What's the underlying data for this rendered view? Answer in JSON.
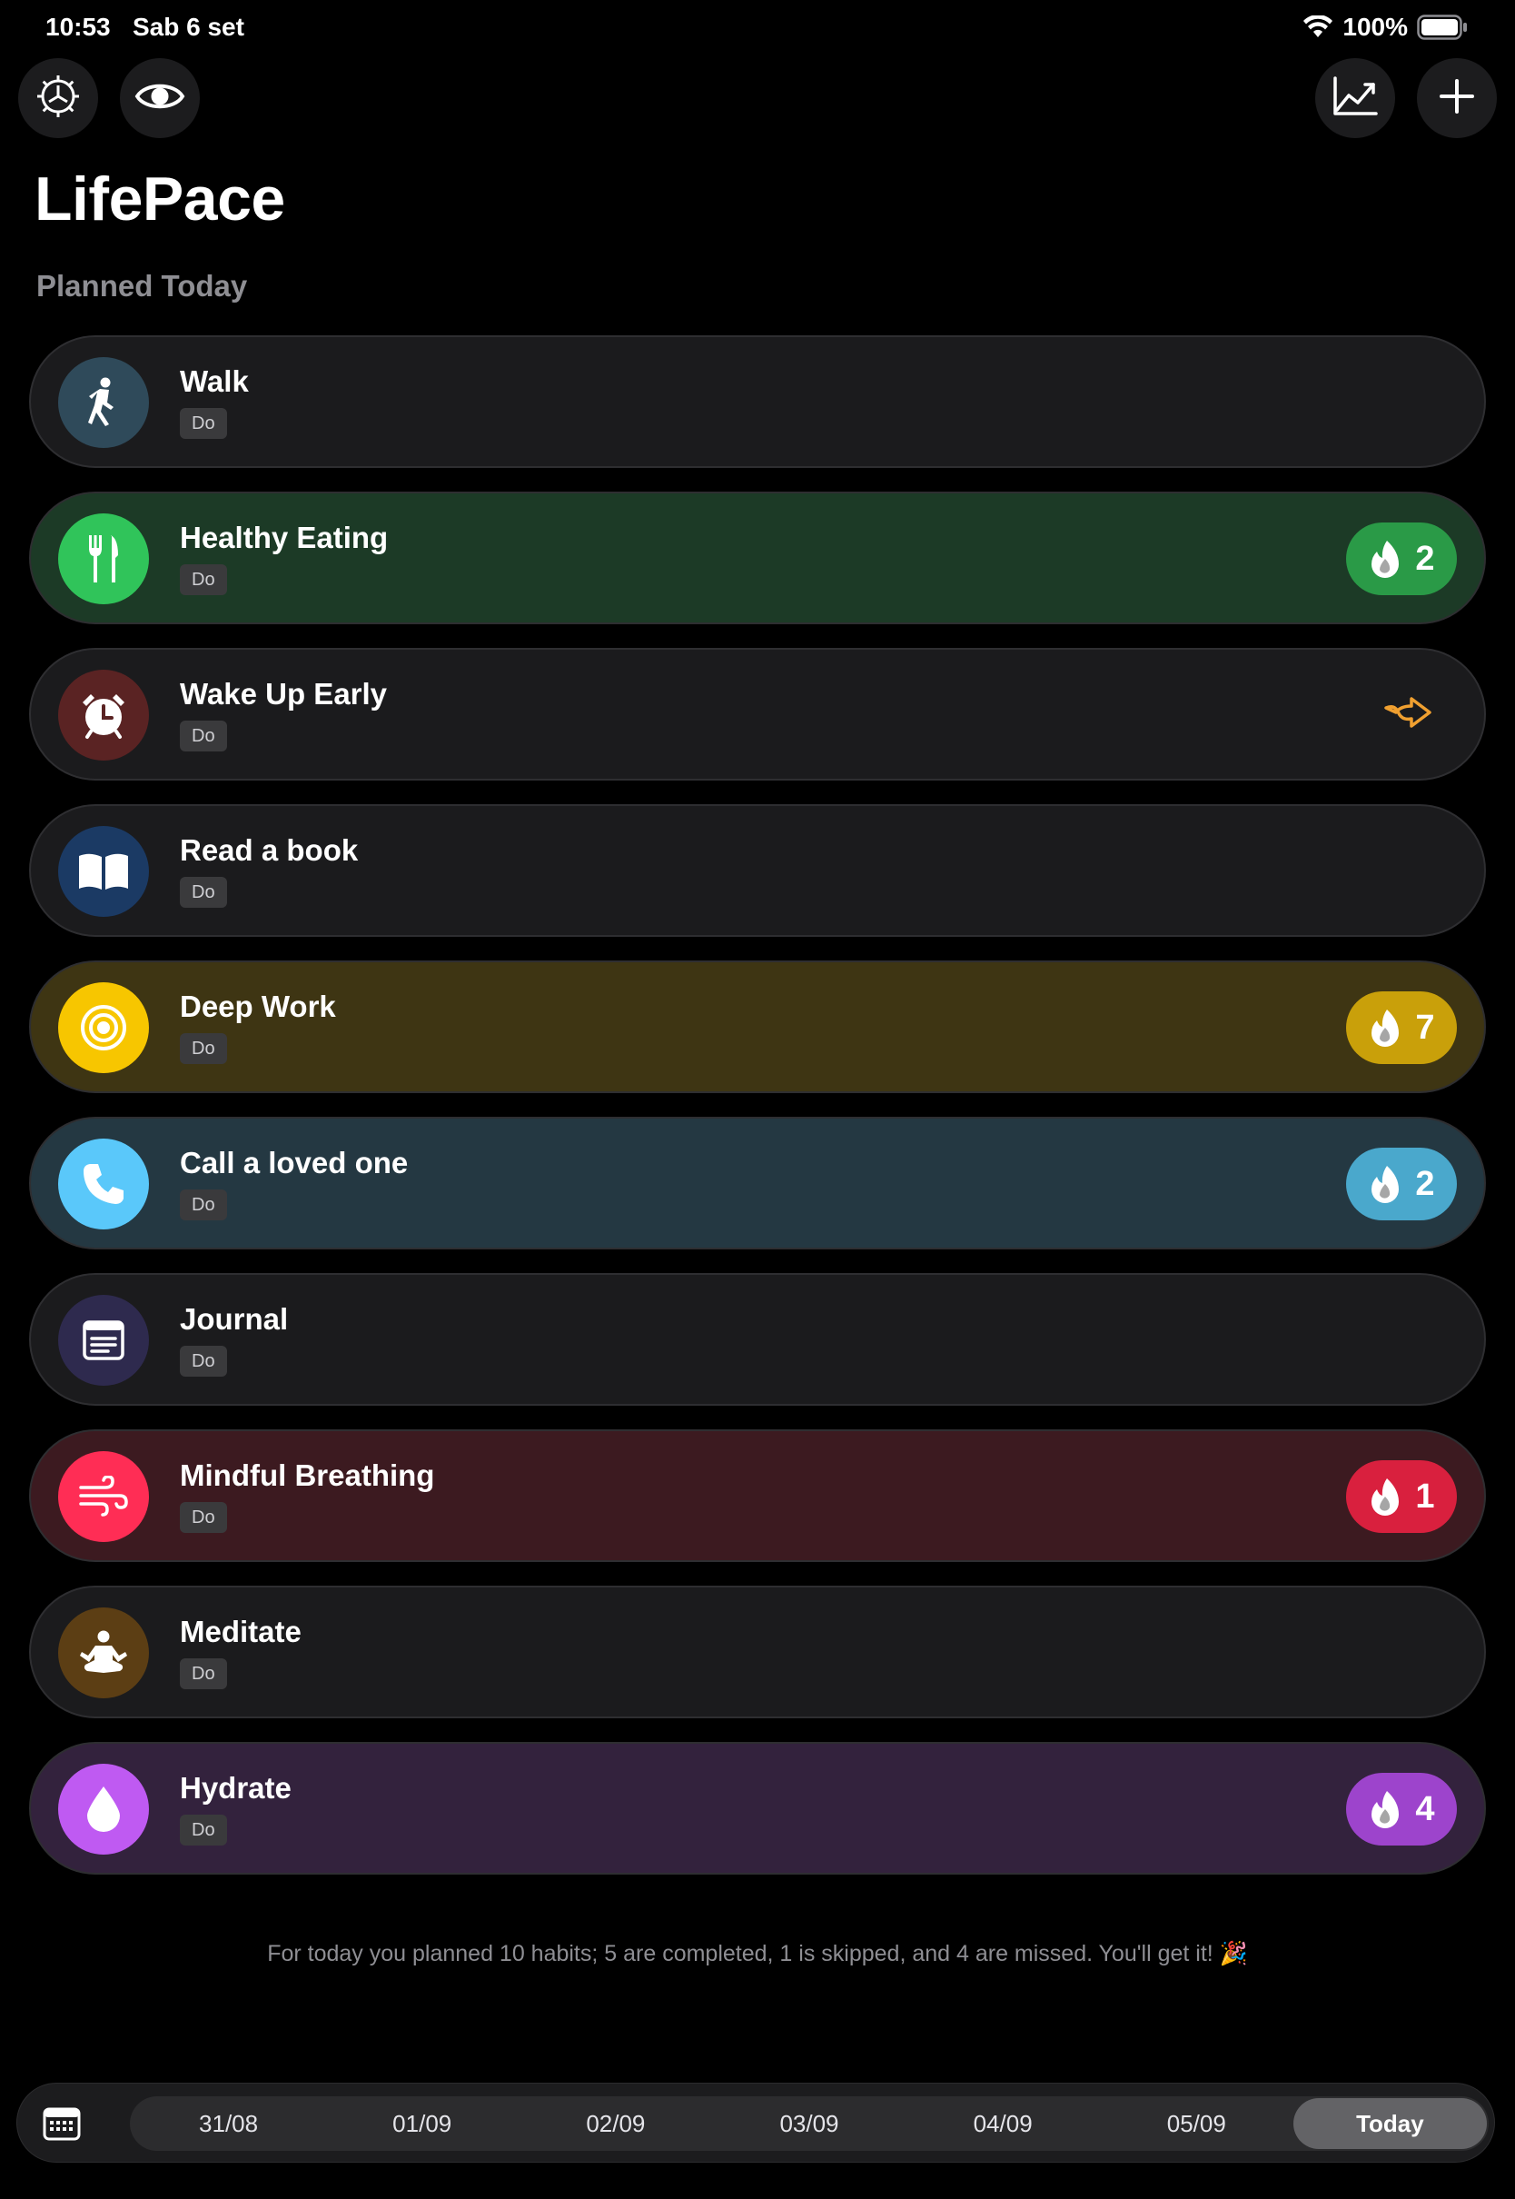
{
  "status_bar": {
    "time": "10:53",
    "date": "Sab 6 set",
    "battery": "100%"
  },
  "toolbar": {
    "left_icons": [
      "settings-gear-icon",
      "eye-icon"
    ],
    "right_icons": [
      "chart-line-icon",
      "plus-icon"
    ]
  },
  "app_title": "LifePace",
  "section_title": "Planned Today",
  "habits": [
    {
      "name": "Walk",
      "tag": "Do",
      "icon": "walk-icon",
      "streak": null,
      "bg": "#1b1b1d",
      "icon_bg": "#2f4a5a"
    },
    {
      "name": "Healthy Eating",
      "tag": "Do",
      "icon": "fork-knife-icon",
      "streak": "2",
      "bg": "#1c3a26",
      "icon_bg": "#30c45a",
      "badge_bg": "#2a9a47"
    },
    {
      "name": "Wake Up Early",
      "tag": "Do",
      "icon": "alarm-clock-icon",
      "streak": null,
      "skipped": true,
      "bg": "#1b1b1d",
      "icon_bg": "#5a2323"
    },
    {
      "name": "Read a book",
      "tag": "Do",
      "icon": "book-icon",
      "streak": null,
      "bg": "#1b1b1d",
      "icon_bg": "#1b3a64"
    },
    {
      "name": "Deep Work",
      "tag": "Do",
      "icon": "target-icon",
      "streak": "7",
      "bg": "#3e3513",
      "icon_bg": "#f7c600",
      "badge_bg": "#c9a00a"
    },
    {
      "name": "Call a loved one",
      "tag": "Do",
      "icon": "phone-icon",
      "streak": "2",
      "bg": "#243842",
      "icon_bg": "#5ac8fa",
      "badge_bg": "#4aa8cc"
    },
    {
      "name": "Journal",
      "tag": "Do",
      "icon": "journal-icon",
      "streak": null,
      "bg": "#1b1b1d",
      "icon_bg": "#2e2a4e"
    },
    {
      "name": "Mindful Breathing",
      "tag": "Do",
      "icon": "wind-icon",
      "streak": "1",
      "bg": "#3c1a20",
      "icon_bg": "#ff2d55",
      "badge_bg": "#d9203e"
    },
    {
      "name": "Meditate",
      "tag": "Do",
      "icon": "meditate-icon",
      "streak": null,
      "bg": "#1b1b1d",
      "icon_bg": "#5c3e14"
    },
    {
      "name": "Hydrate",
      "tag": "Do",
      "icon": "water-drop-icon",
      "streak": "4",
      "bg": "#33223d",
      "icon_bg": "#bf5af2",
      "badge_bg": "#9d44cc"
    }
  ],
  "summary": "For today you planned 10 habits; 5 are completed, 1 is skipped, and 4 are missed. You'll get it! 🎉",
  "date_strip": {
    "dates": [
      "31/08",
      "01/09",
      "02/09",
      "03/09",
      "04/09",
      "05/09",
      "Today"
    ],
    "selected": "Today"
  }
}
